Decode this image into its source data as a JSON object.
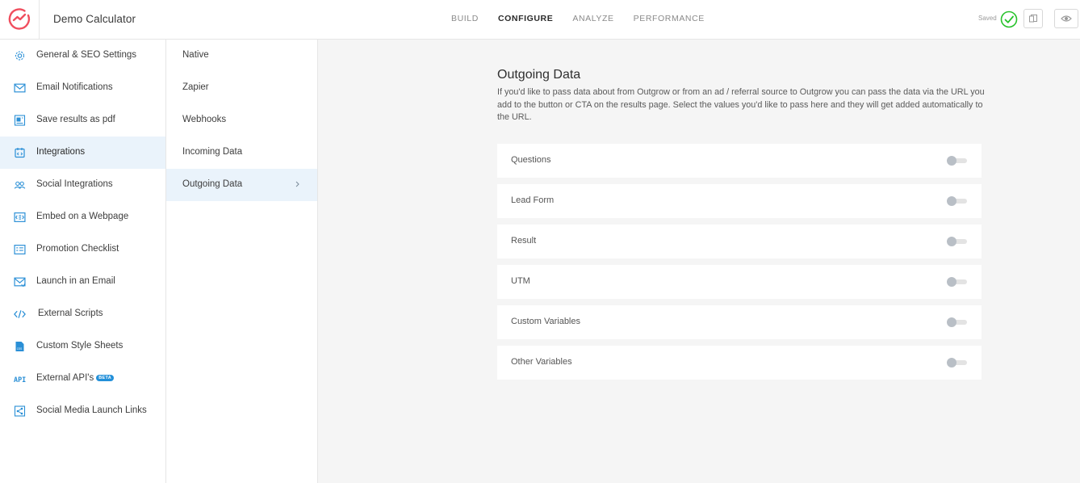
{
  "header": {
    "app_title": "Demo Calculator",
    "nav": [
      {
        "label": "BUILD",
        "active": false
      },
      {
        "label": "CONFIGURE",
        "active": true
      },
      {
        "label": "ANALYZE",
        "active": false
      },
      {
        "label": "PERFORMANCE",
        "active": false
      }
    ],
    "saved_label": "Saved",
    "brand_color": "#f04e5e",
    "saved_color": "#26c22a"
  },
  "sidebar": {
    "items": [
      {
        "label": "General & SEO Settings",
        "icon": "gear-icon"
      },
      {
        "label": "Email Notifications",
        "icon": "envelope-icon"
      },
      {
        "label": "Save results as pdf",
        "icon": "pdf-icon"
      },
      {
        "label": "Integrations",
        "icon": "integration-icon",
        "active": true
      },
      {
        "label": "Social Integrations",
        "icon": "people-icon"
      },
      {
        "label": "Embed on a Webpage",
        "icon": "embed-icon"
      },
      {
        "label": "Promotion Checklist",
        "icon": "checklist-icon"
      },
      {
        "label": "Launch in an Email",
        "icon": "envelope-icon"
      },
      {
        "label": "External Scripts",
        "icon": "code-icon"
      },
      {
        "label": "Custom Style Sheets",
        "icon": "css-file-icon"
      },
      {
        "label": "External API's",
        "icon": "api-icon",
        "badge": "BETA"
      },
      {
        "label": "Social Media Launch Links",
        "icon": "share-icon"
      }
    ]
  },
  "submenu": {
    "items": [
      {
        "label": "Native"
      },
      {
        "label": "Zapier"
      },
      {
        "label": "Webhooks"
      },
      {
        "label": "Incoming Data"
      },
      {
        "label": "Outgoing Data",
        "active": true
      }
    ]
  },
  "main": {
    "title": "Outgoing Data",
    "description": "If you'd like to pass data about from Outgrow or from an ad / referral source to Outgrow you can pass the data via the URL you add to the button or CTA on the results page. Select the values you'd like to pass here and they will get added automatically to the URL.",
    "rows": [
      {
        "label": "Questions",
        "enabled": false
      },
      {
        "label": "Lead Form",
        "enabled": false
      },
      {
        "label": "Result",
        "enabled": false
      },
      {
        "label": "UTM",
        "enabled": false
      },
      {
        "label": "Custom Variables",
        "enabled": false
      },
      {
        "label": "Other Variables",
        "enabled": false
      }
    ]
  }
}
